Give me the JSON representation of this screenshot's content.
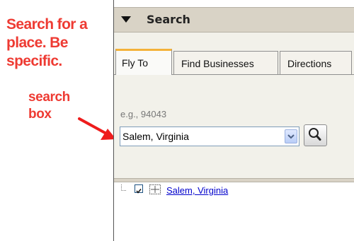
{
  "annotations": {
    "main": "Search for a place.  Be specific.",
    "search_box": "search box"
  },
  "panel": {
    "header_title": "Search",
    "icons": {
      "collapse": "triangle-down-icon",
      "search": "magnifier-icon",
      "dropdown": "chevron-down-icon",
      "place": "placemark-grid-icon"
    }
  },
  "tabs": [
    {
      "label": "Fly To",
      "active": true
    },
    {
      "label": "Find Businesses",
      "active": false
    },
    {
      "label": "Directions",
      "active": false
    }
  ],
  "fly_to": {
    "placeholder": "e.g., 94043",
    "value": "Salem, Virginia"
  },
  "results": [
    {
      "label": "Salem, Virginia",
      "checked": true
    }
  ],
  "colors": {
    "annotation": "#ee3b33",
    "header_bg": "#d9d3c6",
    "active_tab_accent": "#f4b23a",
    "link": "#0000cc"
  }
}
